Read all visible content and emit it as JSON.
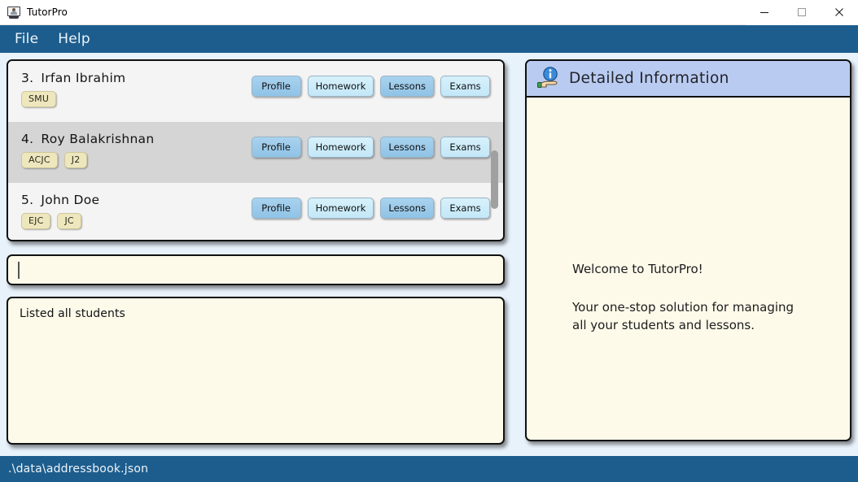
{
  "window": {
    "title": "TutorPro",
    "icon": "app-window-person-icon",
    "minimize_label": "—",
    "maximize_label": "□",
    "close_label": "✕"
  },
  "menubar": {
    "items": [
      {
        "label": "File"
      },
      {
        "label": "Help"
      }
    ]
  },
  "student_list": {
    "rows": [
      {
        "index": "3.",
        "name": "Irfan Ibrahim",
        "selected": false,
        "tags": [
          "SMU"
        ],
        "buttons": [
          {
            "label": "Profile",
            "style": "dark"
          },
          {
            "label": "Homework",
            "style": "light"
          },
          {
            "label": "Lessons",
            "style": "dark"
          },
          {
            "label": "Exams",
            "style": "light"
          }
        ]
      },
      {
        "index": "4.",
        "name": "Roy Balakrishnan",
        "selected": true,
        "tags": [
          "ACJC",
          "J2"
        ],
        "buttons": [
          {
            "label": "Profile",
            "style": "dark"
          },
          {
            "label": "Homework",
            "style": "light"
          },
          {
            "label": "Lessons",
            "style": "dark"
          },
          {
            "label": "Exams",
            "style": "light"
          }
        ]
      },
      {
        "index": "5.",
        "name": "John Doe",
        "selected": false,
        "tags": [
          "EJC",
          "JC"
        ],
        "buttons": [
          {
            "label": "Profile",
            "style": "dark"
          },
          {
            "label": "Homework",
            "style": "light"
          },
          {
            "label": "Lessons",
            "style": "dark"
          },
          {
            "label": "Exams",
            "style": "light"
          }
        ]
      }
    ]
  },
  "command_box": {
    "value": "",
    "placeholder": ""
  },
  "result_box": {
    "text": "Listed all students"
  },
  "detail_panel": {
    "icon": "info-on-hand-icon",
    "title": "Detailed Information",
    "welcome_title": "Welcome to TutorPro!",
    "welcome_body_line1": "Your one-stop solution for managing",
    "welcome_body_line2": "all your students and lessons."
  },
  "statusbar": {
    "path": ".\\data\\addressbook.json"
  },
  "colors": {
    "menubar": "#1d5d8e",
    "workarea": "#e8f2fb",
    "panel_bg": "#fdfaea",
    "row_bg": "#f4f4f4",
    "row_selected_bg": "#d5d5d5",
    "tag_bg": "#eee7bd",
    "detail_header_bg": "#b9cbf0",
    "button_dark": "#9ecbea",
    "button_light": "#cdecfa"
  }
}
